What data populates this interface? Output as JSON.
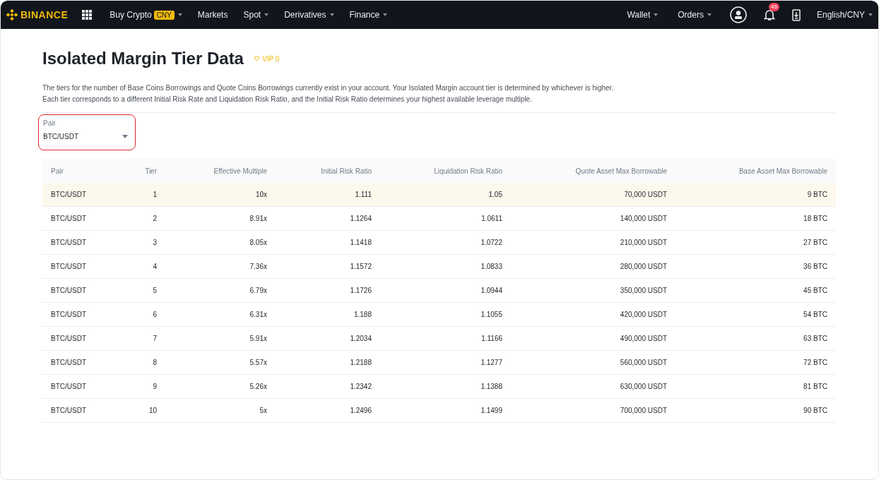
{
  "nav": {
    "logo": "BINANCE",
    "items": [
      {
        "label": "Buy Crypto",
        "badge": "CNY",
        "dropdown": true
      },
      {
        "label": "Markets",
        "dropdown": false
      },
      {
        "label": "Spot",
        "dropdown": true
      },
      {
        "label": "Derivatives",
        "dropdown": true
      },
      {
        "label": "Finance",
        "dropdown": true
      }
    ],
    "right_items": [
      {
        "label": "Wallet",
        "dropdown": true
      },
      {
        "label": "Orders",
        "dropdown": true
      }
    ],
    "notification_count": "45",
    "language": "English/CNY"
  },
  "page": {
    "title": "Isolated Margin Tier Data",
    "vip": "VIP 0",
    "description": [
      "The tiers for the number of Base Coins Borrowings and Quote Coins Borrowings currently exist in your account. Your Isolated Margin account tier is determined by whichever is higher.",
      "Each tier corresponds to a different Initial Risk Rate and Liquidation Risk Ratio, and the Initial Risk Ratio determines your highest available leverage multiple."
    ]
  },
  "pair_select": {
    "label": "Pair",
    "value": "BTC/USDT",
    "highlighted": true
  },
  "table": {
    "columns": [
      "Pair",
      "Tier",
      "Effective Multiple",
      "Initial Risk Ratio",
      "Liquidation Risk Ratio",
      "Quote Asset Max Borrowable",
      "Base Asset Max Borrowable"
    ],
    "rows": [
      {
        "selected": true,
        "cells": [
          "BTC/USDT",
          "1",
          "10x",
          "1.111",
          "1.05",
          "70,000 USDT",
          "9 BTC"
        ]
      },
      {
        "selected": false,
        "cells": [
          "BTC/USDT",
          "2",
          "8.91x",
          "1.1264",
          "1.0611",
          "140,000 USDT",
          "18 BTC"
        ]
      },
      {
        "selected": false,
        "cells": [
          "BTC/USDT",
          "3",
          "8.05x",
          "1.1418",
          "1.0722",
          "210,000 USDT",
          "27 BTC"
        ]
      },
      {
        "selected": false,
        "cells": [
          "BTC/USDT",
          "4",
          "7.36x",
          "1.1572",
          "1.0833",
          "280,000 USDT",
          "36 BTC"
        ]
      },
      {
        "selected": false,
        "cells": [
          "BTC/USDT",
          "5",
          "6.79x",
          "1.1726",
          "1.0944",
          "350,000 USDT",
          "45 BTC"
        ]
      },
      {
        "selected": false,
        "cells": [
          "BTC/USDT",
          "6",
          "6.31x",
          "1.188",
          "1.1055",
          "420,000 USDT",
          "54 BTC"
        ]
      },
      {
        "selected": false,
        "cells": [
          "BTC/USDT",
          "7",
          "5.91x",
          "1.2034",
          "1.1166",
          "490,000 USDT",
          "63 BTC"
        ]
      },
      {
        "selected": false,
        "cells": [
          "BTC/USDT",
          "8",
          "5.57x",
          "1.2188",
          "1.1277",
          "560,000 USDT",
          "72 BTC"
        ]
      },
      {
        "selected": false,
        "cells": [
          "BTC/USDT",
          "9",
          "5.26x",
          "1.2342",
          "1.1388",
          "630,000 USDT",
          "81 BTC"
        ]
      },
      {
        "selected": false,
        "cells": [
          "BTC/USDT",
          "10",
          "5x",
          "1.2496",
          "1.1499",
          "700,000 USDT",
          "90 BTC"
        ]
      }
    ]
  }
}
